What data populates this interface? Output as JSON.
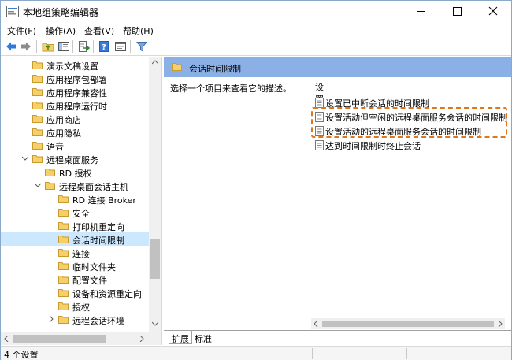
{
  "window": {
    "title": "本地组策略编辑器"
  },
  "menu": [
    "文件(F)",
    "操作(A)",
    "查看(V)",
    "帮助(H)"
  ],
  "toolbar": {
    "icons": [
      "back-arrow-icon",
      "forward-arrow-icon",
      "up-folder-icon",
      "show-hide-tree-icon",
      "export-list-icon",
      "help-icon",
      "properties-icon",
      "filter-icon"
    ]
  },
  "tree": {
    "items": [
      {
        "label": "演示文稿设置",
        "level": 1
      },
      {
        "label": "应用程序包部署",
        "level": 1
      },
      {
        "label": "应用程序兼容性",
        "level": 1
      },
      {
        "label": "应用程序运行时",
        "level": 1
      },
      {
        "label": "应用商店",
        "level": 1
      },
      {
        "label": "应用隐私",
        "level": 1
      },
      {
        "label": "语音",
        "level": 1
      },
      {
        "label": "远程桌面服务",
        "level": 1,
        "expanded": true
      },
      {
        "label": "RD 授权",
        "level": 2
      },
      {
        "label": "远程桌面会话主机",
        "level": 2,
        "expanded": true
      },
      {
        "label": "RD 连接 Broker",
        "level": 3
      },
      {
        "label": "安全",
        "level": 3
      },
      {
        "label": "打印机重定向",
        "level": 3
      },
      {
        "label": "会话时间限制",
        "level": 3,
        "selected": true
      },
      {
        "label": "连接",
        "level": 3
      },
      {
        "label": "临时文件夹",
        "level": 3
      },
      {
        "label": "配置文件",
        "level": 3
      },
      {
        "label": "设备和资源重定向",
        "level": 3
      },
      {
        "label": "授权",
        "level": 3
      },
      {
        "label": "远程会话环境",
        "level": 3,
        "collapsed": true
      }
    ]
  },
  "right": {
    "header_title": "会话时间限制",
    "description": "选择一个项目来查看它的描述。",
    "settings_header": "设置",
    "settings": [
      "设置已中断会话的时间限制",
      "设置活动但空闲的远程桌面服务会话的时间限制",
      "设置活动的远程桌面服务会话的时间限制",
      "达到时间限制时终止会话"
    ],
    "tabs": [
      "扩展",
      "标准"
    ]
  },
  "status": {
    "text": "4 个设置"
  },
  "colors": {
    "header_bg": "#8ab0e6",
    "selected_bg": "#cce8ff",
    "highlight": "#e0761b",
    "folder": "#f5cf6a"
  }
}
